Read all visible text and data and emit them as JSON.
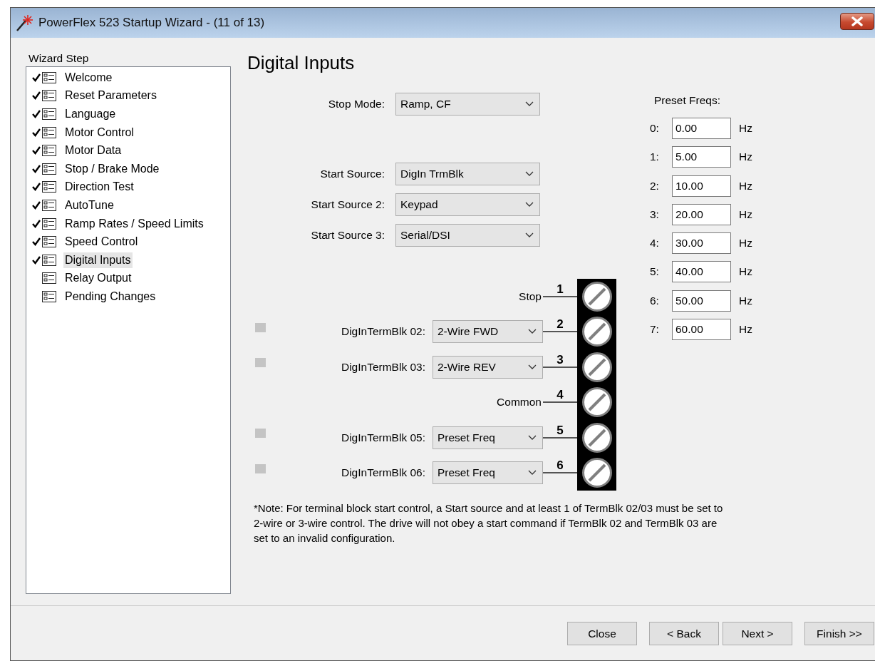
{
  "window": {
    "title": "PowerFlex 523 Startup Wizard - (11 of 13)"
  },
  "sidebar": {
    "title": "Wizard Step",
    "items": [
      {
        "label": "Welcome",
        "checked": true,
        "selected": false
      },
      {
        "label": "Reset Parameters",
        "checked": true,
        "selected": false
      },
      {
        "label": "Language",
        "checked": true,
        "selected": false
      },
      {
        "label": "Motor Control",
        "checked": true,
        "selected": false
      },
      {
        "label": "Motor Data",
        "checked": true,
        "selected": false
      },
      {
        "label": "Stop / Brake Mode",
        "checked": true,
        "selected": false
      },
      {
        "label": "Direction Test",
        "checked": true,
        "selected": false
      },
      {
        "label": "AutoTune",
        "checked": true,
        "selected": false
      },
      {
        "label": "Ramp Rates / Speed Limits",
        "checked": true,
        "selected": false
      },
      {
        "label": "Speed Control",
        "checked": true,
        "selected": false
      },
      {
        "label": "Digital Inputs",
        "checked": true,
        "selected": true
      },
      {
        "label": "Relay Output",
        "checked": false,
        "selected": false
      },
      {
        "label": "Pending Changes",
        "checked": false,
        "selected": false
      }
    ]
  },
  "page": {
    "heading": "Digital Inputs",
    "stop_mode": {
      "label": "Stop Mode:",
      "value": "Ramp, CF"
    },
    "start_sources": [
      {
        "label": "Start Source:",
        "value": "DigIn TrmBlk"
      },
      {
        "label": "Start Source 2:",
        "value": "Keypad"
      },
      {
        "label": "Start Source 3:",
        "value": "Serial/DSI"
      }
    ],
    "terminals": [
      {
        "number": "1",
        "kind": "fixed",
        "label": "Stop"
      },
      {
        "number": "2",
        "kind": "select",
        "label": "DigInTermBlk 02:",
        "value": "2-Wire FWD",
        "active": false
      },
      {
        "number": "3",
        "kind": "select",
        "label": "DigInTermBlk 03:",
        "value": "2-Wire REV",
        "active": false
      },
      {
        "number": "4",
        "kind": "fixed",
        "label": "Common"
      },
      {
        "number": "5",
        "kind": "select",
        "label": "DigInTermBlk 05:",
        "value": "Preset Freq",
        "active": false
      },
      {
        "number": "6",
        "kind": "select",
        "label": "DigInTermBlk 06:",
        "value": "Preset Freq",
        "active": false
      }
    ],
    "preset_freqs": {
      "title": "Preset Freqs:",
      "rows": [
        {
          "index": "0:",
          "value": "0.00",
          "unit": "Hz"
        },
        {
          "index": "1:",
          "value": "5.00",
          "unit": "Hz"
        },
        {
          "index": "2:",
          "value": "10.00",
          "unit": "Hz"
        },
        {
          "index": "3:",
          "value": "20.00",
          "unit": "Hz"
        },
        {
          "index": "4:",
          "value": "30.00",
          "unit": "Hz"
        },
        {
          "index": "5:",
          "value": "40.00",
          "unit": "Hz"
        },
        {
          "index": "6:",
          "value": "50.00",
          "unit": "Hz"
        },
        {
          "index": "7:",
          "value": "60.00",
          "unit": "Hz"
        }
      ]
    },
    "note": "*Note:  For terminal block start control, a Start source and at least 1 of TermBlk 02/03 must be set to 2-wire or 3-wire control. The drive will not obey a start command if TermBlk 02 and TermBlk 03 are set to an invalid configuration."
  },
  "buttons": [
    {
      "label": "Close"
    },
    {
      "label": "< Back"
    },
    {
      "label": "Next >"
    },
    {
      "label": "Finish >>"
    }
  ]
}
